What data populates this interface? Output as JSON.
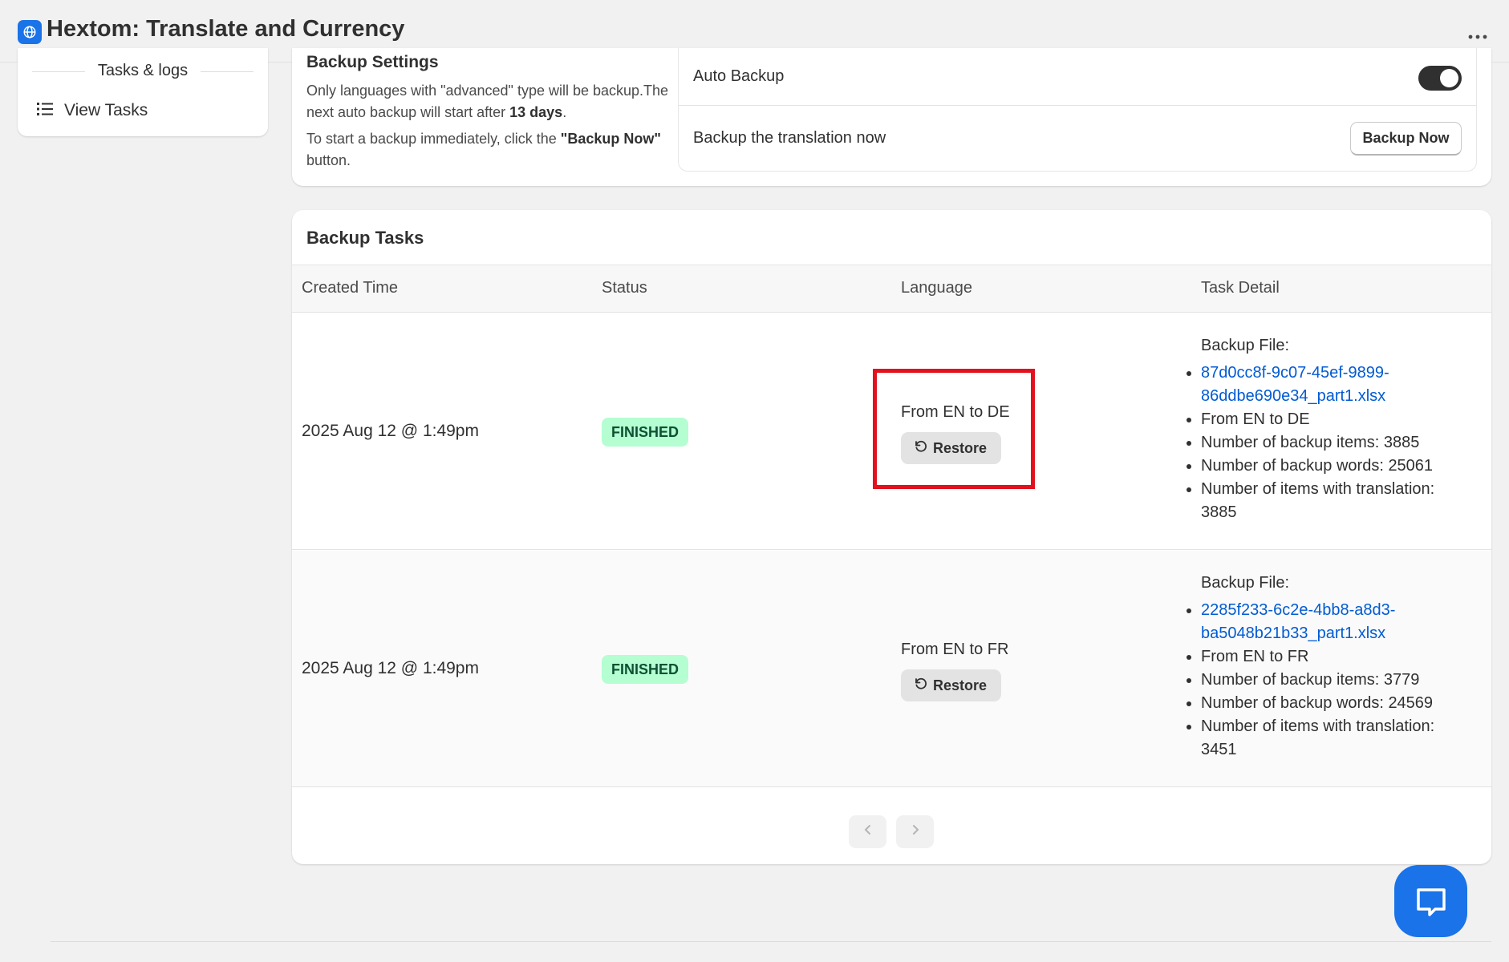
{
  "app": {
    "title": "Hextom: Translate and Currency"
  },
  "sidebar": {
    "section_label": "Tasks & logs",
    "items": [
      {
        "label": "View Tasks",
        "icon": "list-icon"
      }
    ]
  },
  "backup_settings": {
    "title": "Backup Settings",
    "desc_1_pre": "Only languages with \"advanced\" type will be backup.The next auto backup will start after ",
    "desc_1_bold": "13 days",
    "desc_1_post": ".",
    "desc_2_pre": "To start a backup immediately, click the ",
    "desc_2_bold": "\"Backup Now\"",
    "desc_2_post": " button.",
    "auto_backup_label": "Auto Backup",
    "auto_backup_enabled": true,
    "backup_now_label": "Backup the translation now",
    "backup_now_button": "Backup Now"
  },
  "backup_tasks": {
    "title": "Backup Tasks",
    "columns": [
      "Created Time",
      "Status",
      "Language",
      "Task Detail"
    ],
    "rows": [
      {
        "created": "2025 Aug 12 @ 1:49pm",
        "status": "FINISHED",
        "language": "From EN to DE",
        "restore_label": "Restore",
        "detail_heading": "Backup File:",
        "file_line1": "87d0cc8f-9c07-45ef-9899-",
        "file_line2": "86ddbe690e34_part1.xlsx",
        "direction": "From EN to DE",
        "items": "Number of backup items: 3885",
        "words": "Number of backup words: 25061",
        "translated_label": "Number of items with translation:",
        "translated_value": "3885"
      },
      {
        "created": "2025 Aug 12 @ 1:49pm",
        "status": "FINISHED",
        "language": "From EN to FR",
        "restore_label": "Restore",
        "detail_heading": "Backup File:",
        "file_line1": "2285f233-6c2e-4bb8-a8d3-",
        "file_line2": "ba5048b21b33_part1.xlsx",
        "direction": "From EN to FR",
        "items": "Number of backup items: 3779",
        "words": "Number of backup words: 24569",
        "translated_label": "Number of items with translation:",
        "translated_value": "3451"
      }
    ]
  },
  "colors": {
    "accent_blue": "#1a73e8",
    "link_blue": "#005bd3",
    "badge_green_bg": "#b4fed2",
    "badge_green_text": "#0c5132",
    "highlight_red": "#e3101e"
  },
  "icons": {
    "app": "globe-icon",
    "more": "more-horizontal-icon",
    "restore": "undo-icon",
    "prev": "chevron-left-icon",
    "next": "chevron-right-icon",
    "chat": "chat-bubble-icon"
  }
}
